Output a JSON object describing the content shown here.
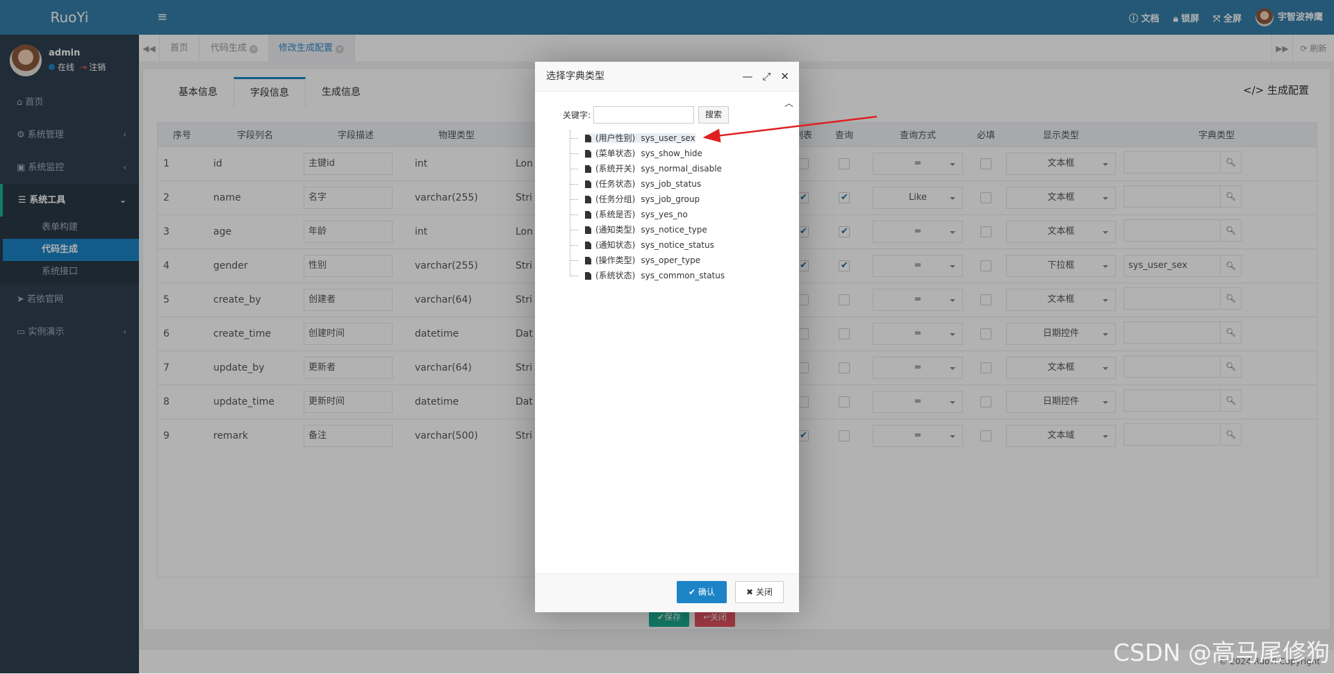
{
  "app": {
    "brand": "RuoYi"
  },
  "user": {
    "name": "admin",
    "status": "在线",
    "logout": "注销"
  },
  "sidebar": {
    "items": [
      {
        "label": "首页"
      },
      {
        "label": "系统管理"
      },
      {
        "label": "系统监控"
      },
      {
        "label": "系统工具"
      },
      {
        "label": "若依官网"
      },
      {
        "label": "实例演示"
      }
    ],
    "sub": [
      "表单构建",
      "代码生成",
      "系统接口"
    ]
  },
  "topbar": {
    "doc": "文档",
    "lock": "锁屏",
    "fullscreen": "全屏",
    "username": "宇智波神鹰"
  },
  "page_tabs": [
    "首页",
    "代码生成",
    "修改生成配置"
  ],
  "refresh": "刷新",
  "content_tabs": [
    "基本信息",
    "字段信息",
    "生成信息"
  ],
  "gen_config": "生成配置",
  "table": {
    "headers": [
      "序号",
      "字段列名",
      "字段描述",
      "物理类型",
      "列表",
      "查询",
      "查询方式",
      "必填",
      "显示类型",
      "字典类型"
    ],
    "rows": [
      {
        "no": "1",
        "col": "id",
        "desc": "主键id",
        "type": "int",
        "java": "Lon",
        "list": false,
        "query": false,
        "qtype": "=",
        "req": false,
        "html": "文本框",
        "dict": ""
      },
      {
        "no": "2",
        "col": "name",
        "desc": "名字",
        "type": "varchar(255)",
        "java": "Stri",
        "list": true,
        "query": true,
        "qtype": "Like",
        "req": false,
        "html": "文本框",
        "dict": ""
      },
      {
        "no": "3",
        "col": "age",
        "desc": "年龄",
        "type": "int",
        "java": "Lon",
        "list": true,
        "query": true,
        "qtype": "=",
        "req": false,
        "html": "文本框",
        "dict": ""
      },
      {
        "no": "4",
        "col": "gender",
        "desc": "性别",
        "type": "varchar(255)",
        "java": "Stri",
        "list": true,
        "query": true,
        "qtype": "=",
        "req": false,
        "html": "下拉框",
        "dict": "sys_user_sex"
      },
      {
        "no": "5",
        "col": "create_by",
        "desc": "创建者",
        "type": "varchar(64)",
        "java": "Stri",
        "list": false,
        "query": false,
        "qtype": "=",
        "req": false,
        "html": "文本框",
        "dict": ""
      },
      {
        "no": "6",
        "col": "create_time",
        "desc": "创建时间",
        "type": "datetime",
        "java": "Dat",
        "list": false,
        "query": false,
        "qtype": "=",
        "req": false,
        "html": "日期控件",
        "dict": ""
      },
      {
        "no": "7",
        "col": "update_by",
        "desc": "更新者",
        "type": "varchar(64)",
        "java": "Stri",
        "list": false,
        "query": false,
        "qtype": "=",
        "req": false,
        "html": "文本框",
        "dict": ""
      },
      {
        "no": "8",
        "col": "update_time",
        "desc": "更新时间",
        "type": "datetime",
        "java": "Dat",
        "list": false,
        "query": false,
        "qtype": "=",
        "req": false,
        "html": "日期控件",
        "dict": ""
      },
      {
        "no": "9",
        "col": "remark",
        "desc": "备注",
        "type": "varchar(500)",
        "java": "Stri",
        "list": true,
        "query": false,
        "qtype": "=",
        "req": false,
        "html": "文本域",
        "dict": ""
      }
    ]
  },
  "buttons": {
    "save": "保存",
    "close": "关闭"
  },
  "footer": "© 2024 RuoYi Copyright",
  "modal": {
    "title": "选择字典类型",
    "keyword_label": "关键字:",
    "search": "搜索",
    "confirm": "确认",
    "close": "关闭",
    "tree": [
      {
        "label": "(用户性别)",
        "code": "sys_user_sex"
      },
      {
        "label": "(菜单状态)",
        "code": "sys_show_hide"
      },
      {
        "label": "(系统开关)",
        "code": "sys_normal_disable"
      },
      {
        "label": "(任务状态)",
        "code": "sys_job_status"
      },
      {
        "label": "(任务分组)",
        "code": "sys_job_group"
      },
      {
        "label": "(系统是否)",
        "code": "sys_yes_no"
      },
      {
        "label": "(通知类型)",
        "code": "sys_notice_type"
      },
      {
        "label": "(通知状态)",
        "code": "sys_notice_status"
      },
      {
        "label": "(操作类型)",
        "code": "sys_oper_type"
      },
      {
        "label": "(系统状态)",
        "code": "sys_common_status"
      }
    ]
  },
  "watermark": "CSDN @高马尾修狗",
  "colors": {
    "sidebar": "#2f4050",
    "header": "#367fa9",
    "primary": "#1c84c6",
    "annotation_arrow": "#e02020"
  }
}
